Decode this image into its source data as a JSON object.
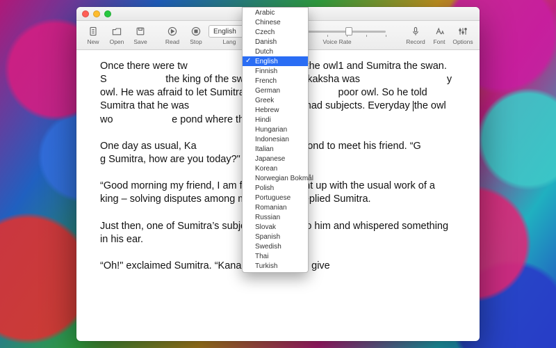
{
  "toolbar": {
    "new": "New",
    "open": "Open",
    "save": "Save",
    "read": "Read",
    "stop": "Stop",
    "lang": "Lang",
    "voice_rate": "Voice Rate",
    "record": "Record",
    "font": "Font",
    "options": "Options",
    "language_value": "English"
  },
  "document": {
    "p1a": "Once there were tw",
    "p1b": "anakaksha the owl1 and Sumitra the swan. S",
    "p1c": "the king of the swans. But Kanakaksha was",
    "p1d": "y owl. He was afraid to let Sumitra know th",
    "p1e": "poor owl. So he told Sumitra that he was",
    "p1f": "and also had subjects. Everyday ",
    "p1g": "the owl wo",
    "p1h": "e pond where the swan lived.",
    "p2a": "One day as usual, Ka",
    "p2b": "ew to the pond to meet his friend. “G",
    "p2c": "g Sumitra, how are you today?\" he asked.",
    "p3": "“Good morning my friend, I am fine. Just caught up with the usual work of a king – solving disputes among my subjects,\" replied Sumitra.",
    "p4": "Just then, one of Sumitra’s subjects came up to him and whispered something in his ear.",
    "p5": "“Oh!\" exclaimed Sumitra. “Kanakaksha, please give"
  },
  "language_menu": {
    "selected": "English",
    "items": [
      "Arabic",
      "Chinese",
      "Czech",
      "Danish",
      "Dutch",
      "English",
      "Finnish",
      "French",
      "German",
      "Greek",
      "Hebrew",
      "Hindi",
      "Hungarian",
      "Indonesian",
      "Italian",
      "Japanese",
      "Korean",
      "Norwegian Bokmål",
      "Polish",
      "Portuguese",
      "Romanian",
      "Russian",
      "Slovak",
      "Spanish",
      "Swedish",
      "Thai",
      "Turkish"
    ]
  }
}
